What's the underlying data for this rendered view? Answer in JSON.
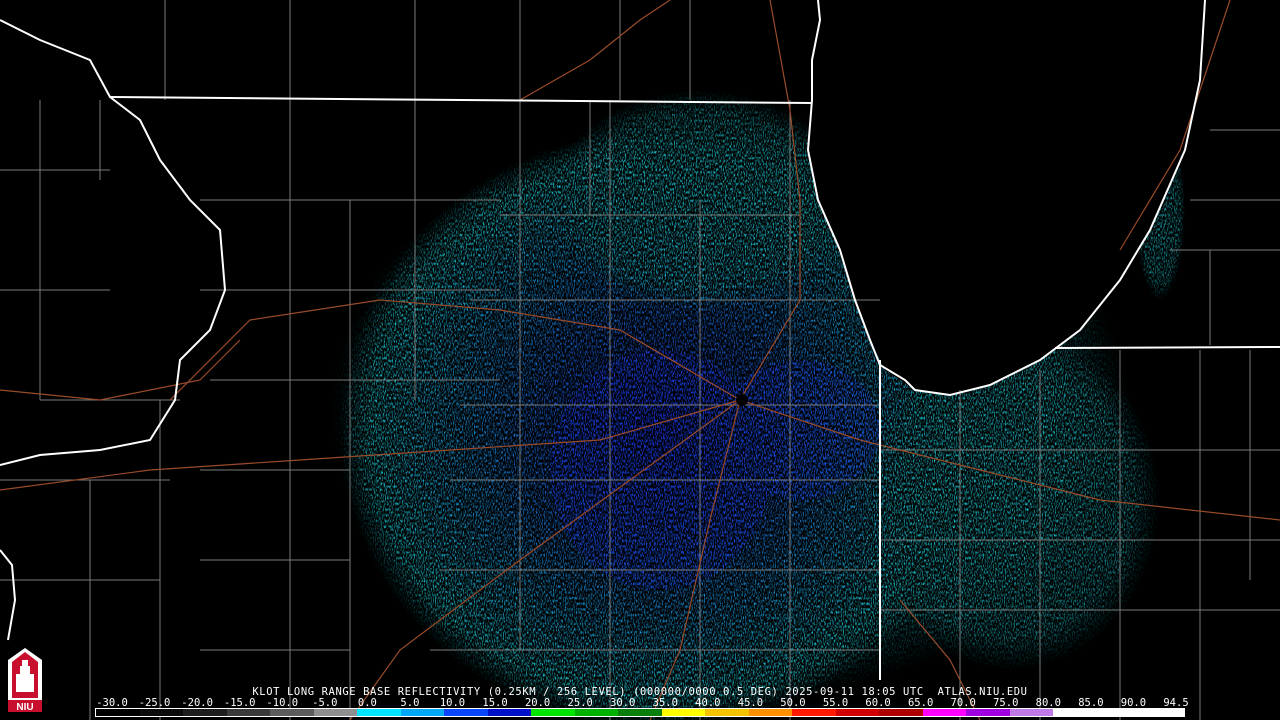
{
  "caption": "KLOT LONG RANGE BASE REFLECTIVITY (0.25KM / 256 LEVEL) (000000/0000 0.5 DEG) 2025-09-11 18:05 UTC  ATLAS.NIU.EDU",
  "logo": {
    "text": "NIU",
    "icon": "university-tower-icon"
  },
  "colorscale": {
    "labels": [
      "-30.0",
      "-25.0",
      "-20.0",
      "-15.0",
      "-10.0",
      "-5.0",
      "0.0",
      "5.0",
      "10.0",
      "15.0",
      "20.0",
      "25.0",
      "30.0",
      "35.0",
      "40.0",
      "45.0",
      "50.0",
      "55.0",
      "60.0",
      "65.0",
      "70.0",
      "75.0",
      "80.0",
      "85.0",
      "90.0",
      "94.5"
    ],
    "colors": [
      "#000000",
      "#0b0b0b",
      "#1e1e1e",
      "#3a3a3a",
      "#5c5c5c",
      "#8f8f8f",
      "#00e5ff",
      "#00a8f5",
      "#0a46ff",
      "#0010c8",
      "#00e400",
      "#00b100",
      "#0a7e0a",
      "#ffff00",
      "#f5c400",
      "#ff9000",
      "#ff1a00",
      "#d10000",
      "#b00000",
      "#ff00ff",
      "#a000e0",
      "#c07ae8",
      "#ffffff",
      "#ffffff",
      "#ffffff"
    ]
  },
  "map": {
    "radar_site": "KLOT",
    "colors": {
      "background": "#000000",
      "state_lines": "#ffffff",
      "county_lines": "#7a7a7a",
      "highways": "#9a4b2a",
      "echo_light": "#1fe2f0",
      "echo_mid": "#1aa3f0",
      "echo_heavy": "#1a33e0"
    }
  }
}
